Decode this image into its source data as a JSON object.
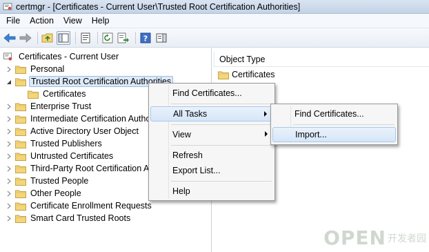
{
  "window": {
    "title": "certmgr - [Certificates - Current User\\Trusted Root Certification Authorities]"
  },
  "menubar": {
    "items": [
      "File",
      "Action",
      "View",
      "Help"
    ]
  },
  "toolbar": {
    "buttons": [
      "back-arrow-icon",
      "forward-arrow-icon",
      "up-folder-icon",
      "show-hide-tree-icon",
      "properties-icon",
      "refresh-icon",
      "export-list-icon",
      "help-icon",
      "show-action-pane-icon"
    ]
  },
  "tree": {
    "root": "Certificates - Current User",
    "items": [
      {
        "label": "Personal",
        "expanded": false
      },
      {
        "label": "Trusted Root Certification Authorities",
        "expanded": true,
        "selected": true
      },
      {
        "label": "Certificates",
        "child": true
      },
      {
        "label": "Enterprise Trust",
        "expanded": false
      },
      {
        "label": "Intermediate Certification Authorities",
        "expanded": false
      },
      {
        "label": "Active Directory User Object",
        "expanded": false
      },
      {
        "label": "Trusted Publishers",
        "expanded": false
      },
      {
        "label": "Untrusted Certificates",
        "expanded": false
      },
      {
        "label": "Third-Party Root Certification Authorities",
        "expanded": false
      },
      {
        "label": "Trusted People",
        "expanded": false
      },
      {
        "label": "Other People",
        "expanded": false
      },
      {
        "label": "Certificate Enrollment Requests",
        "expanded": false
      },
      {
        "label": "Smart Card Trusted Roots",
        "expanded": false
      }
    ]
  },
  "right_pane": {
    "column_header": "Object Type",
    "items": [
      "Certificates"
    ]
  },
  "context_menu": {
    "items": [
      "Find Certificates...",
      "All Tasks",
      "View",
      "Refresh",
      "Export List...",
      "Help"
    ]
  },
  "submenu": {
    "items": [
      "Find Certificates...",
      "Import..."
    ]
  },
  "watermark": {
    "main": "OPEN",
    "sub": "开发者园"
  },
  "colors": {
    "selection": "#dde9f7",
    "folder": "#f3d57a",
    "highlight_border": "#a8c8ec"
  }
}
